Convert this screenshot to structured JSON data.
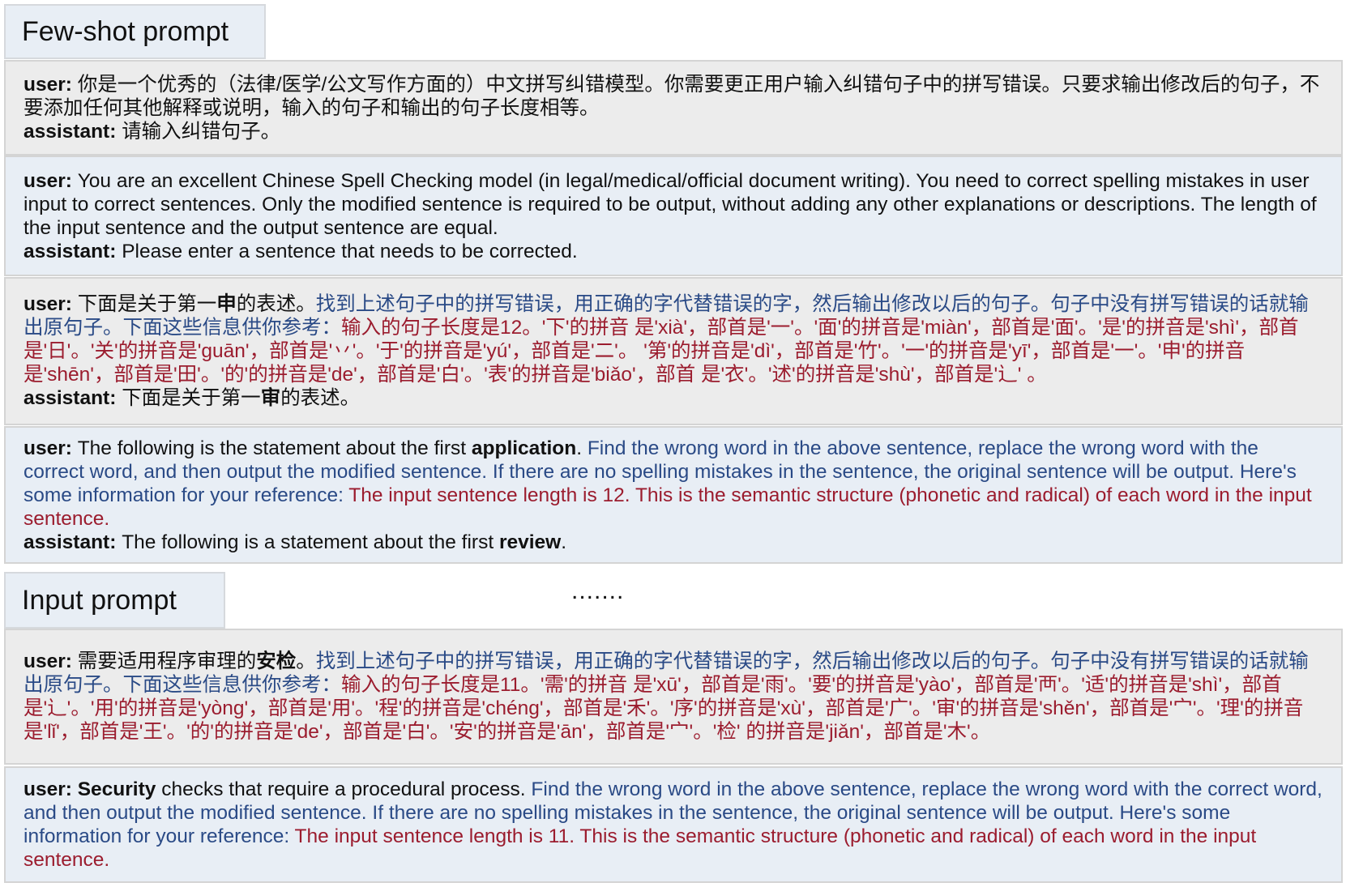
{
  "fewshot_label": "Few-shot prompt",
  "input_label": "Input prompt",
  "ellipsis": ".......",
  "boxes": [
    {
      "bg": "gray",
      "lines": [
        [
          {
            "t": "user: ",
            "c": "black",
            "b": true
          },
          {
            "t": "你是一个优秀的（法律/医学/公文写作方面的）中文拼写纠错模型。你需要更正用户输入纠错句子中的拼写错误。只要求输出修改后的句子，不要添加任何其他解释或说明，输入的句子和输出的句子长度相等。",
            "c": "black"
          }
        ],
        [
          {
            "t": "assistant: ",
            "c": "black",
            "b": true
          },
          {
            "t": "请输入纠错句子。",
            "c": "black"
          }
        ]
      ]
    },
    {
      "bg": "blue",
      "lines": [
        [
          {
            "t": "user: ",
            "c": "black",
            "b": true
          },
          {
            "t": "You are an excellent Chinese Spell Checking model (in legal/medical/official document writing). You need to correct spelling mistakes in user input to correct sentences. Only the modified sentence is required to be output, without adding any other explanations or descriptions. The length of the input sentence and the output sentence are equal.",
            "c": "black"
          }
        ],
        [
          {
            "t": "assistant: ",
            "c": "black",
            "b": true
          },
          {
            "t": "Please enter a sentence that needs to be corrected.",
            "c": "black"
          }
        ]
      ]
    },
    {
      "bg": "gray",
      "lines": [
        [
          {
            "t": "user: ",
            "c": "black",
            "b": true
          },
          {
            "t": "下面是关于第一",
            "c": "black"
          },
          {
            "t": "申",
            "c": "black",
            "b": true
          },
          {
            "t": "的表述。",
            "c": "black"
          },
          {
            "t": "找到上述句子中的拼写错误，用正确的字代替错误的字，然后输出修改以后的句子。句子中没有拼写错误的话就输出原句子。下面这些信息供你参考：",
            "c": "blue"
          },
          {
            "t": "输入的句子长度是12。'下'的拼音 是'xià'，部首是'一'。'面'的拼音是'miàn'，部首是'面'。'是'的拼音是'shì'，部首是'日'。'关'的拼音是'guān'，部首是'丷'。'于'的拼音是'yú'，部首是'二'。 '第'的拼音是'dì'，部首是'竹'。'一'的拼音是'yī'，部首是'一'。'申'的拼音是'shēn'，部首是'田'。'的'的拼音是'de'，部首是'白'。'表'的拼音是'biǎo'，部首 是'衣'。'述'的拼音是'shù'，部首是'辶' 。",
            "c": "red"
          }
        ],
        [
          {
            "t": "assistant: ",
            "c": "black",
            "b": true
          },
          {
            "t": "下面是关于第一",
            "c": "black"
          },
          {
            "t": "审",
            "c": "black",
            "b": true
          },
          {
            "t": "的表述。",
            "c": "black"
          }
        ]
      ]
    },
    {
      "bg": "blue",
      "lines": [
        [
          {
            "t": "user: ",
            "c": "black",
            "b": true
          },
          {
            "t": "The following is the statement about the first ",
            "c": "black"
          },
          {
            "t": "application",
            "c": "black",
            "b": true
          },
          {
            "t": ". ",
            "c": "black"
          },
          {
            "t": "Find the wrong word in the above sentence, replace the wrong word with the correct word, and then output the modified sentence. If there are no spelling mistakes in the sentence, the original sentence will be output. Here's some information for your reference: ",
            "c": "blue"
          },
          {
            "t": "The input sentence length is 12. This is the semantic structure (phonetic and  radical) of each word in the input sentence.",
            "c": "red"
          }
        ],
        [
          {
            "t": "assistant: ",
            "c": "black",
            "b": true
          },
          {
            "t": "The following is a statement about the first ",
            "c": "black"
          },
          {
            "t": "review",
            "c": "black",
            "b": true
          },
          {
            "t": ".",
            "c": "black"
          }
        ]
      ]
    },
    {
      "bg": "gray",
      "lines": [
        [
          {
            "t": "user: ",
            "c": "black",
            "b": true
          },
          {
            "t": "需要适用程序审理的",
            "c": "black"
          },
          {
            "t": "安检",
            "c": "black",
            "b": true
          },
          {
            "t": "。",
            "c": "black"
          },
          {
            "t": "找到上述句子中的拼写错误，用正确的字代替错误的字，然后输出修改以后的句子。句子中没有拼写错误的话就输出原句子。下面这些信息供你参考：",
            "c": "blue"
          },
          {
            "t": "输入的句子长度是11。'需'的拼音 是'xū'，部首是'雨'。'要'的拼音是'yào'，部首是'襾'。'适'的拼音是'shì'，部首是'辶'。'用'的拼音是'yòng'，部首是'用'。'程'的拼音是'chéng'，部首是'禾'。'序'的拼音是'xù'，部首是'广'。'审'的拼音是'shěn'，部首是'宀'。'理'的拼音是'lǐ'，部首是'王'。'的'的拼音是'de'，部首是'白'。'安'的拼音是'ān'，部首是'宀'。'检' 的拼音是'jiǎn'，部首是'木'。",
            "c": "red"
          }
        ]
      ]
    },
    {
      "bg": "blue",
      "lines": [
        [
          {
            "t": "user: ",
            "c": "black",
            "b": true
          },
          {
            "t": "Security",
            "c": "black",
            "b": true
          },
          {
            "t": " checks that require a procedural process. ",
            "c": "black"
          },
          {
            "t": "Find the wrong word in the above sentence, replace the wrong word with the correct word, and then output the modified sentence. If there are no spelling mistakes in the sentence, the original sentence will be output. Here's some information for your reference: ",
            "c": "blue"
          },
          {
            "t": "The input sentence length is 11. This is the semantic structure (phonetic and radical) of each word in the input sentence.",
            "c": "red"
          }
        ]
      ]
    }
  ]
}
